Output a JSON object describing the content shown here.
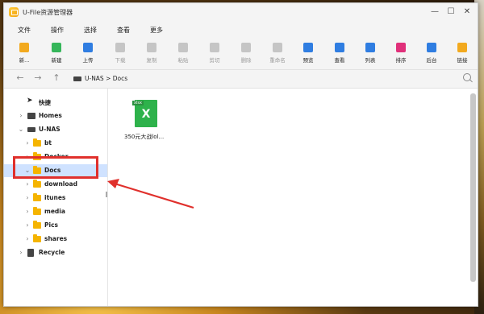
{
  "window": {
    "title": "U-File资源管理器",
    "minimize": "—",
    "maximize": "☐",
    "close": "✕"
  },
  "menu": [
    "文件",
    "操作",
    "选择",
    "查看",
    "更多"
  ],
  "toolbar": [
    {
      "label": "新...",
      "icon": "new-file-icon",
      "color": "#f2a91e",
      "enabled": true
    },
    {
      "label": "新建",
      "icon": "new-folder-icon",
      "color": "#35b65a",
      "enabled": true
    },
    {
      "label": "上传",
      "icon": "upload-icon",
      "color": "#2f7de1",
      "enabled": true
    },
    {
      "label": "下载",
      "icon": "download-icon",
      "color": "#c5c5c5",
      "enabled": false
    },
    {
      "label": "复制",
      "icon": "copy-icon",
      "color": "#c5c5c5",
      "enabled": false
    },
    {
      "label": "粘贴",
      "icon": "paste-icon",
      "color": "#c5c5c5",
      "enabled": false
    },
    {
      "label": "剪切",
      "icon": "cut-icon",
      "color": "#c5c5c5",
      "enabled": false
    },
    {
      "label": "删除",
      "icon": "delete-icon",
      "color": "#c5c5c5",
      "enabled": false
    },
    {
      "label": "重命名",
      "icon": "rename-icon",
      "color": "#c5c5c5",
      "enabled": false
    },
    {
      "label": "预览",
      "icon": "preview-icon",
      "color": "#2f7de1",
      "enabled": true
    },
    {
      "label": "查看",
      "icon": "view-icon",
      "color": "#2f7de1",
      "enabled": true
    },
    {
      "label": "列表",
      "icon": "list-icon",
      "color": "#2f7de1",
      "enabled": true
    },
    {
      "label": "排序",
      "icon": "sort-icon",
      "color": "#e0307a",
      "enabled": true
    },
    {
      "label": "后台",
      "icon": "background-icon",
      "color": "#2f7de1",
      "enabled": true
    },
    {
      "label": "链接",
      "icon": "link-icon",
      "color": "#f2a91e",
      "enabled": true
    }
  ],
  "address": {
    "path": "U-NAS > Docs"
  },
  "sidebar": {
    "quick": "快捷",
    "homes": "Homes",
    "unas": "U-NAS",
    "folders": [
      "bt",
      "Docker",
      "Docs",
      "download",
      "itunes",
      "media",
      "Pics",
      "shares"
    ],
    "recycle": "Recycle",
    "selected": "Docs"
  },
  "files": [
    {
      "name": "350元大战lol...",
      "type": "xlsx",
      "tag": "xlsx"
    }
  ],
  "annotation": {
    "color": "#e0302c"
  }
}
